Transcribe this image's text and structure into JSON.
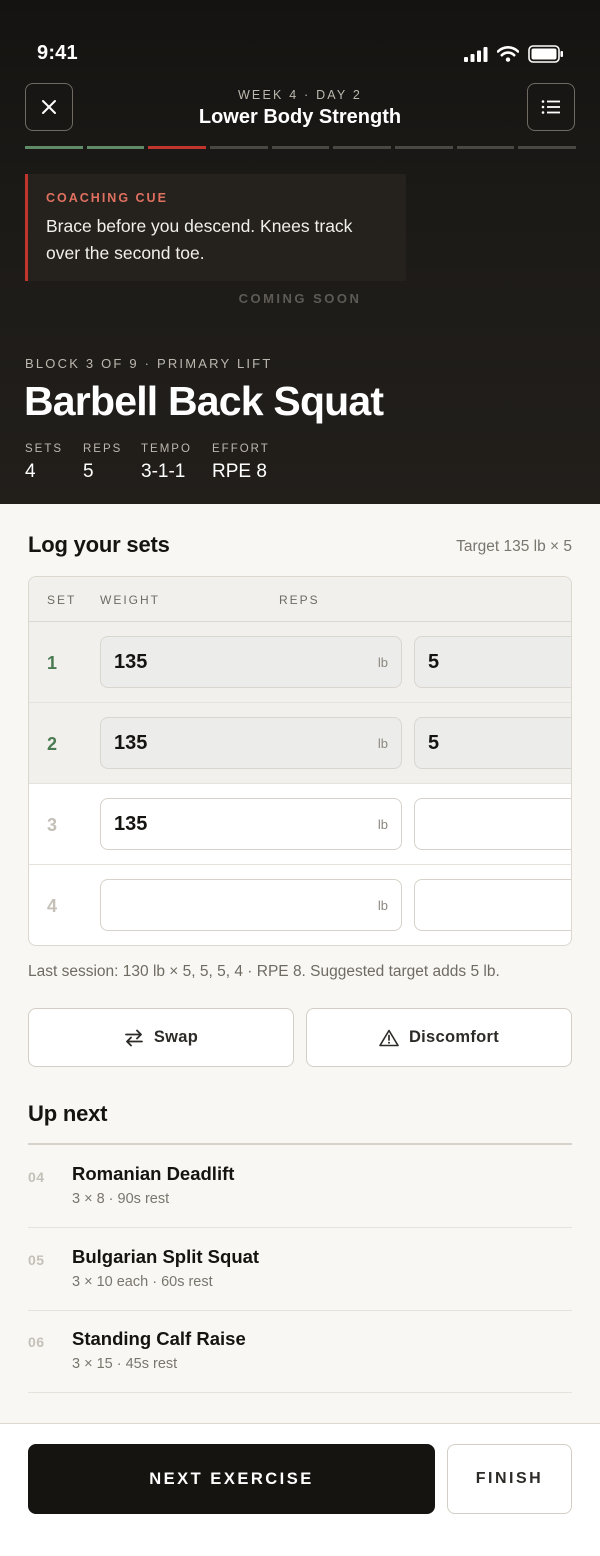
{
  "status": {
    "time": "9:41"
  },
  "header": {
    "subtitle": "WEEK 4 · DAY 2",
    "title": "Lower Body Strength",
    "progress": {
      "total": 9,
      "done": 2,
      "current": 3
    }
  },
  "coaching": {
    "label": "COACHING CUE",
    "text": "Brace before you descend. Knees track over the second toe."
  },
  "coming_soon": "COMING SOON",
  "exercise": {
    "block_label": "BLOCK 3 OF 9 · PRIMARY LIFT",
    "name": "Barbell Back Squat",
    "stats": [
      {
        "label": "SETS",
        "value": "4"
      },
      {
        "label": "REPS",
        "value": "5"
      },
      {
        "label": "TEMPO",
        "value": "3-1-1"
      },
      {
        "label": "EFFORT",
        "value": "RPE 8"
      }
    ]
  },
  "log": {
    "title": "Log your sets",
    "target": "Target 135 lb × 5",
    "columns": {
      "set": "SET",
      "weight": "WEIGHT",
      "reps": "REPS"
    },
    "unit": "lb",
    "sets": [
      {
        "num": "1",
        "weight": "135",
        "reps": "5",
        "state": "done"
      },
      {
        "num": "2",
        "weight": "135",
        "reps": "5",
        "state": "done"
      },
      {
        "num": "3",
        "weight": "135",
        "reps": "",
        "state": "todo"
      },
      {
        "num": "4",
        "weight": "",
        "reps": "",
        "state": "todo"
      }
    ],
    "last_session": "Last session: 130 lb × 5, 5, 5, 4 · RPE 8. Suggested target adds 5 lb."
  },
  "actions": {
    "swap": "Swap",
    "discomfort": "Discomfort"
  },
  "up_next": {
    "title": "Up next",
    "items": [
      {
        "num": "04",
        "name": "Romanian Deadlift",
        "meta": "3 × 8 · 90s rest"
      },
      {
        "num": "05",
        "name": "Bulgarian Split Squat",
        "meta": "3 × 10 each · 60s rest"
      },
      {
        "num": "06",
        "name": "Standing Calf Raise",
        "meta": "3 × 15 · 45s rest"
      }
    ]
  },
  "footer": {
    "next": "NEXT EXERCISE",
    "finish": "FINISH"
  },
  "colors": {
    "accent_red": "#c0362c",
    "done_green": "#5f8c67",
    "dark": "#151411"
  }
}
